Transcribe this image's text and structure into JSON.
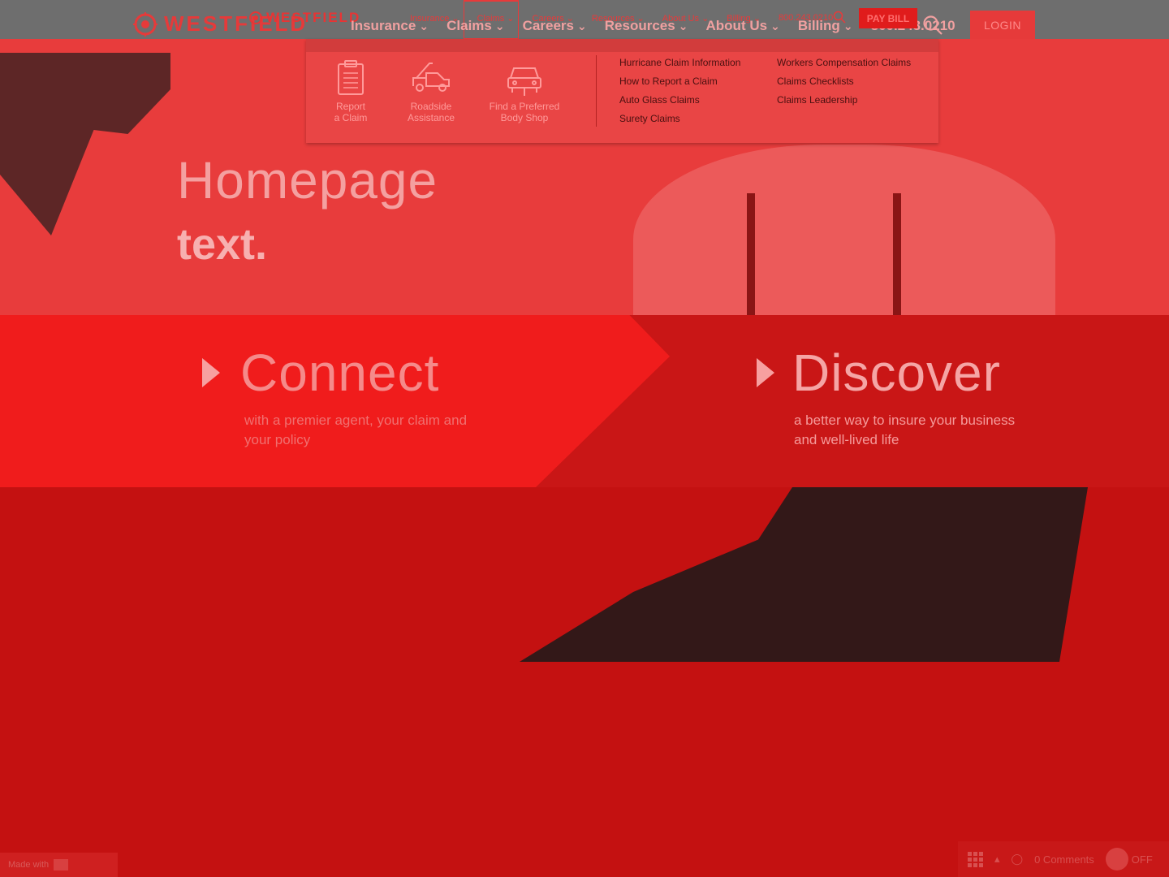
{
  "brand": {
    "name": "WESTFIELD",
    "name_small": "WESTFIELD"
  },
  "nav": {
    "items": [
      "Insurance",
      "Claims",
      "Careers",
      "Resources",
      "About Us",
      "Billing"
    ],
    "phone": "800.243.0210",
    "ghost_items": [
      "Insurance",
      "Claims",
      "Careers",
      "Resources",
      "About Us",
      "Billing"
    ],
    "ghost_phone": "800.243.0210",
    "pay_bill_label": "PAY BILL",
    "login_label": "LOGIN"
  },
  "claims_menu": {
    "tiles": [
      {
        "line1": "Report",
        "line2": "a Claim",
        "icon": "clipboard-icon"
      },
      {
        "line1": "Roadside",
        "line2": "Assistance",
        "icon": "tow-truck-icon"
      },
      {
        "line1": "Find a Preferred",
        "line2": "Body Shop",
        "icon": "car-icon"
      }
    ],
    "links_col1": [
      "Hurricane Claim Information",
      "How to Report a Claim",
      "Auto Glass Claims",
      "Surety Claims"
    ],
    "links_col2": [
      "Workers Compensation Claims",
      "Claims Checklists",
      "Claims Leadership"
    ]
  },
  "hero": {
    "title": "Homepage",
    "subtitle": "text."
  },
  "connect": {
    "heading": "Connect",
    "body": "with a premier agent, your claim and your policy"
  },
  "discover": {
    "heading": "Discover",
    "body": "a better way to insure your business and well-lived life"
  },
  "footer": {
    "badge": "Made with",
    "comments": "0 Comments",
    "toggle_label": "OFF"
  },
  "colors": {
    "nav_bg": "#6e6e6e",
    "accent": "#e63a3a",
    "connect_bg": "#f01c1c",
    "band_bg": "#c91616"
  }
}
